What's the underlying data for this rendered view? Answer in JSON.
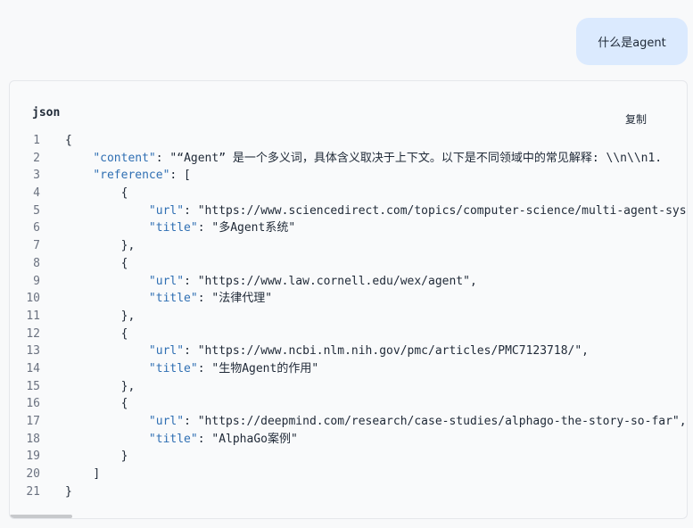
{
  "user_message": "什么是agent",
  "code_block": {
    "language": "json",
    "copy_label": "复制",
    "line_numbers": [
      "1",
      "2",
      "3",
      "4",
      "5",
      "6",
      "7",
      "8",
      "9",
      "10",
      "11",
      "12",
      "13",
      "14",
      "15",
      "16",
      "17",
      "18",
      "19",
      "20",
      "21"
    ],
    "lines": [
      {
        "indent": 0,
        "parts": [
          {
            "t": "p",
            "v": "{"
          }
        ]
      },
      {
        "indent": 1,
        "parts": [
          {
            "t": "k",
            "v": "\"content\""
          },
          {
            "t": "p",
            "v": ": "
          },
          {
            "t": "s",
            "v": "\"“Agent” 是一个多义词，具体含义取决于上下文。以下是不同领域中的常见解释: \\\\n\\\\n1. "
          }
        ]
      },
      {
        "indent": 1,
        "parts": [
          {
            "t": "k",
            "v": "\"reference\""
          },
          {
            "t": "p",
            "v": ": ["
          }
        ]
      },
      {
        "indent": 2,
        "parts": [
          {
            "t": "p",
            "v": "{"
          }
        ]
      },
      {
        "indent": 3,
        "parts": [
          {
            "t": "k",
            "v": "\"url\""
          },
          {
            "t": "p",
            "v": ": "
          },
          {
            "t": "s",
            "v": "\"https://www.sciencedirect.com/topics/computer-science/multi-agent-system\","
          }
        ]
      },
      {
        "indent": 3,
        "parts": [
          {
            "t": "k",
            "v": "\"title\""
          },
          {
            "t": "p",
            "v": ": "
          },
          {
            "t": "s",
            "v": "\"多Agent系统\""
          }
        ]
      },
      {
        "indent": 2,
        "parts": [
          {
            "t": "p",
            "v": "},"
          }
        ]
      },
      {
        "indent": 2,
        "parts": [
          {
            "t": "p",
            "v": "{"
          }
        ]
      },
      {
        "indent": 3,
        "parts": [
          {
            "t": "k",
            "v": "\"url\""
          },
          {
            "t": "p",
            "v": ": "
          },
          {
            "t": "s",
            "v": "\"https://www.law.cornell.edu/wex/agent\","
          }
        ]
      },
      {
        "indent": 3,
        "parts": [
          {
            "t": "k",
            "v": "\"title\""
          },
          {
            "t": "p",
            "v": ": "
          },
          {
            "t": "s",
            "v": "\"法律代理\""
          }
        ]
      },
      {
        "indent": 2,
        "parts": [
          {
            "t": "p",
            "v": "},"
          }
        ]
      },
      {
        "indent": 2,
        "parts": [
          {
            "t": "p",
            "v": "{"
          }
        ]
      },
      {
        "indent": 3,
        "parts": [
          {
            "t": "k",
            "v": "\"url\""
          },
          {
            "t": "p",
            "v": ": "
          },
          {
            "t": "s",
            "v": "\"https://www.ncbi.nlm.nih.gov/pmc/articles/PMC7123718/\","
          }
        ]
      },
      {
        "indent": 3,
        "parts": [
          {
            "t": "k",
            "v": "\"title\""
          },
          {
            "t": "p",
            "v": ": "
          },
          {
            "t": "s",
            "v": "\"生物Agent的作用\""
          }
        ]
      },
      {
        "indent": 2,
        "parts": [
          {
            "t": "p",
            "v": "},"
          }
        ]
      },
      {
        "indent": 2,
        "parts": [
          {
            "t": "p",
            "v": "{"
          }
        ]
      },
      {
        "indent": 3,
        "parts": [
          {
            "t": "k",
            "v": "\"url\""
          },
          {
            "t": "p",
            "v": ": "
          },
          {
            "t": "s",
            "v": "\"https://deepmind.com/research/case-studies/alphago-the-story-so-far\","
          }
        ]
      },
      {
        "indent": 3,
        "parts": [
          {
            "t": "k",
            "v": "\"title\""
          },
          {
            "t": "p",
            "v": ": "
          },
          {
            "t": "s",
            "v": "\"AlphaGo案例\""
          }
        ]
      },
      {
        "indent": 2,
        "parts": [
          {
            "t": "p",
            "v": "}"
          }
        ]
      },
      {
        "indent": 1,
        "parts": [
          {
            "t": "p",
            "v": "]"
          }
        ]
      },
      {
        "indent": 0,
        "parts": [
          {
            "t": "p",
            "v": "}"
          }
        ]
      }
    ]
  },
  "colors": {
    "key": "#2f6fb3",
    "user_bubble": "#dbeafe"
  }
}
